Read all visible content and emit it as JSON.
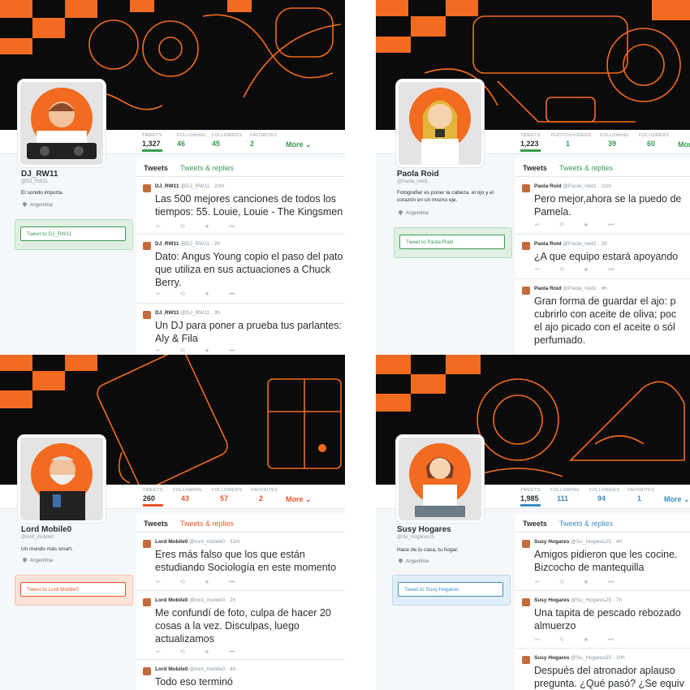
{
  "profiles": [
    {
      "name": "DJ_RW11",
      "handle": "@DJ_RW11",
      "bio": "El sonido importa.",
      "location": "Argentina",
      "tweet_to": "Tweet to DJ_RW11",
      "stats": [
        {
          "label": "TWEETS",
          "value": "1,327"
        },
        {
          "label": "FOLLOWING",
          "value": "46"
        },
        {
          "label": "FOLLOWERS",
          "value": "45"
        },
        {
          "label": "FAVORITES",
          "value": "2"
        }
      ],
      "more": "More ⌄",
      "tabs": [
        "Tweets",
        "Tweets & replies"
      ],
      "accent": "#3a9a4f",
      "tweets": [
        {
          "author": "DJ_RW11",
          "meta": "@DJ_RW11 · 22m",
          "text": "Las 500 mejores canciones de todos los\ntiempos: 55. Louie, Louie - The Kingsmen"
        },
        {
          "author": "DJ_RW11",
          "meta": "@DJ_RW11 · 2h",
          "text": "Dato:  Angus Young copio el paso del pato\nque utiliza en sus actuaciones a Chuck\nBerry."
        },
        {
          "author": "DJ_RW11",
          "meta": "@DJ_RW11 · 3h",
          "text": "Un DJ para poner a prueba tus parlantes:\nAly & Fila"
        }
      ]
    },
    {
      "name": "Paola Roid",
      "handle": "@Paola_roid1",
      "bio": "Fotografiar es poner la cabeza, el ojo y el corazón en un mismo eje.",
      "location": "Argentina",
      "tweet_to": "Tweet to Paola Roid",
      "stats": [
        {
          "label": "TWEETS",
          "value": "1,223"
        },
        {
          "label": "PHOTOS/VIDEOS",
          "value": "1"
        },
        {
          "label": "FOLLOWING",
          "value": "39"
        },
        {
          "label": "FOLLOWERS",
          "value": "60"
        }
      ],
      "more": "Mor",
      "tabs": [
        "Tweets",
        "Tweets & replies"
      ],
      "accent": "#3a9a4f",
      "tweets": [
        {
          "author": "Paola Roid",
          "meta": "@Paola_roid1 · 31m",
          "text": "Pero mejor,ahora se la puedo de\nPamela."
        },
        {
          "author": "Paola Roid",
          "meta": "@Paola_roid1 · 2h",
          "text": "¿A que equipo estará apoyando"
        },
        {
          "author": "Paola Roid",
          "meta": "@Paola_roid1 · 4h",
          "text": "Gran forma de guardar el ajo: p\ncubrirlo con aceite de oliva; poc\nel ajo picado con el aceite o sól\nperfumado."
        }
      ]
    },
    {
      "name": "Lord Mobile0",
      "handle": "@lord_mobile0",
      "bio": "Un mundo más smart.",
      "location": "Argentina",
      "tweet_to": "Tweet to Lord Mobile0",
      "stats": [
        {
          "label": "TWEETS",
          "value": "260"
        },
        {
          "label": "FOLLOWING",
          "value": "43"
        },
        {
          "label": "FOLLOWERS",
          "value": "57"
        },
        {
          "label": "FAVORITES",
          "value": "2"
        }
      ],
      "more": "More ⌄",
      "tabs": [
        "Tweets",
        "Tweets & replies"
      ],
      "accent": "#e8552b",
      "tweets": [
        {
          "author": "Lord Mobile0",
          "meta": "@lord_mobile0 · 32m",
          "text": "Eres más falso que los que están\nestudiando Sociología en este momento"
        },
        {
          "author": "Lord Mobile0",
          "meta": "@lord_mobile0 · 2h",
          "text": "Me confundí de foto, culpa de hacer 20\ncosas a la vez. Disculpas, luego\nactualizamos"
        },
        {
          "author": "Lord Mobile0",
          "meta": "@lord_mobile0 · 4h",
          "text": "Todo eso terminó"
        }
      ]
    },
    {
      "name": "Susy Hogares",
      "handle": "@Su_Hogares25",
      "bio": "Hace de tu casa, tu hogar.",
      "location": "Argentina",
      "tweet_to": "Tweet to Susy Hogares",
      "stats": [
        {
          "label": "TWEETS",
          "value": "1,985"
        },
        {
          "label": "FOLLOWING",
          "value": "111"
        },
        {
          "label": "FOLLOWERS",
          "value": "94"
        },
        {
          "label": "FAVORITES",
          "value": "1"
        }
      ],
      "more": "More ⌄",
      "tabs": [
        "Tweets",
        "Tweets & replies"
      ],
      "accent": "#3a8fc4",
      "tweets": [
        {
          "author": "Susy Hogares",
          "meta": "@Su_Hogares25 · 4h",
          "text": "Amigos pidieron que les cocine.\nBizcocho de mantequilla"
        },
        {
          "author": "Susy Hogares",
          "meta": "@Su_Hogares25 · 7h",
          "text": "Una tapita de pescado rebozado\nalmuerzo"
        },
        {
          "author": "Susy Hogares",
          "meta": "@Su_Hogares25 · 10h",
          "text": "Después del atronador aplauso\npregunta. ¿Qué pasó? ¿Se equiv"
        }
      ]
    }
  ],
  "actions": {
    "reply": "↩",
    "retweet": "⟲",
    "favorite": "★",
    "more": "•••"
  },
  "colors": {
    "orange": "#f26b21",
    "banner": "#0b0b0b"
  }
}
